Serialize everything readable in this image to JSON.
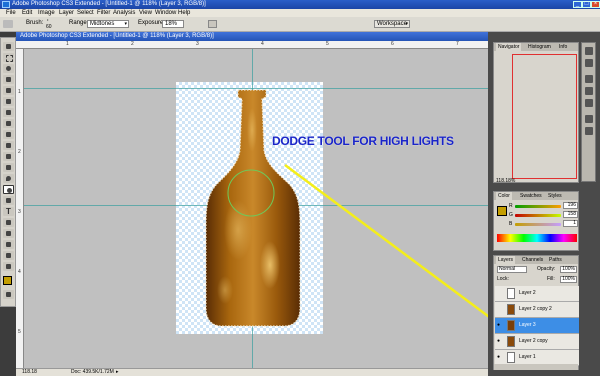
{
  "app": {
    "title": "Adobe Photoshop CS3 Extended - [Untitled-1 @ 118% (Layer 3, RGB/8)]"
  },
  "menu": [
    "File",
    "Edit",
    "Image",
    "Layer",
    "Select",
    "Filter",
    "Analysis",
    "View",
    "Window",
    "Help"
  ],
  "options": {
    "brush_label": "Brush:",
    "brush_size": "60",
    "range_label": "Range:",
    "range_value": "Midtones",
    "exposure_label": "Exposure:",
    "exposure_value": "18%",
    "workspace_label": "Workspace"
  },
  "annotation": {
    "text": "DODGE TOOL FOR HIGH LIGHTS"
  },
  "status": {
    "zoom": "118.18",
    "doc": "Doc: 439.5K/1.72M"
  },
  "navigator": {
    "tabs": [
      "Navigator",
      "Histogram",
      "Info"
    ],
    "zoom": "118.18%"
  },
  "color_panel": {
    "tabs": [
      "Color",
      "Swatches",
      "Styles"
    ],
    "r_label": "R",
    "r_value": "196",
    "g_label": "G",
    "g_value": "158",
    "b_label": "B",
    "b_value": "1"
  },
  "layers_panel": {
    "tabs": [
      "Layers",
      "Channels",
      "Paths"
    ],
    "blend_mode": "Normal",
    "opacity_label": "Opacity:",
    "opacity_value": "100%",
    "lock_label": "Lock:",
    "fill_label": "Fill:",
    "fill_value": "100%",
    "layers": [
      {
        "name": "Layer 2",
        "visible": false,
        "selected": false
      },
      {
        "name": "Layer 2 copy 2",
        "visible": false,
        "selected": false
      },
      {
        "name": "Layer 3",
        "visible": true,
        "selected": true
      },
      {
        "name": "Layer 2 copy",
        "visible": true,
        "selected": false
      },
      {
        "name": "Layer 1",
        "visible": true,
        "selected": false
      }
    ]
  },
  "colors": {
    "foreground": "#c49e01",
    "bottle_dark": "#6b3806",
    "bottle_mid": "#a8660e",
    "bottle_light": "#d99a2c",
    "annotation_color": "#1a25c8",
    "highlight_yellow": "#f4ee1a",
    "selected_layer": "#3d8ee6"
  },
  "icons": {
    "dodge_tool": "dodge-icon",
    "eye": "eye-icon"
  }
}
